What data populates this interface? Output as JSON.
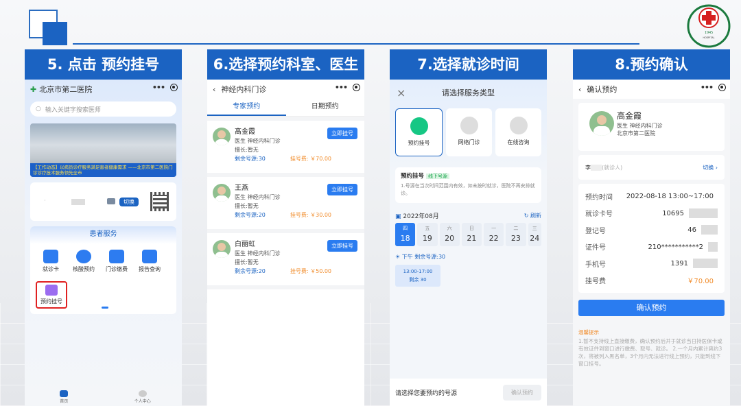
{
  "slides": [
    {
      "title": "5. 点击 预约挂号"
    },
    {
      "title": "6.选择预约科室、医生"
    },
    {
      "title": "7.选择就诊时间"
    },
    {
      "title": "8.预约确认"
    }
  ],
  "screen1": {
    "hospital": "北京市第二医院",
    "search_placeholder": "输入关键字搜索医师",
    "banner_caption": "【工作动态】以病员诊疗服务满足患者健康需求 ——北京市第二医院门诊诊疗技术服务领先全市",
    "card_name": "·",
    "switch_label": "切换",
    "services_title": "患者服务",
    "services": [
      "就诊卡",
      "核酸预约",
      "门诊缴费",
      "报告查询"
    ],
    "highlight_service": "预约挂号",
    "tabbar": [
      "首页",
      "个人中心"
    ]
  },
  "screen2": {
    "dept": "神经内科门诊",
    "tabs": [
      "专家预约",
      "日期预约"
    ],
    "book_label": "立即挂号",
    "doctors": [
      {
        "name": "高金霞",
        "title": "医生 神经内科门诊",
        "skill": "擅长:暂无",
        "remain": "剩余号源:30",
        "fee": "挂号费: ￥70.00"
      },
      {
        "name": "王燕",
        "title": "医生 神经内科门诊",
        "skill": "擅长:暂无",
        "remain": "剩余号源:20",
        "fee": "挂号费: ￥30.00"
      },
      {
        "name": "白丽虹",
        "title": "医生 神经内科门诊",
        "skill": "擅长:暂无",
        "remain": "剩余号源:20",
        "fee": "挂号费: ￥50.00"
      }
    ]
  },
  "screen3": {
    "sheet_title": "请选择服务类型",
    "types": [
      "预约挂号",
      "网络门诊",
      "在线咨询"
    ],
    "desc_title": "预约挂号",
    "desc_tag": "线下号源",
    "desc_text": "1.号源在当次时间范围内有效，如未按时就诊，医院不再安排就诊。",
    "month": "2022年08月",
    "refresh": "刷新",
    "days": [
      {
        "w": "四",
        "d": "18"
      },
      {
        "w": "五",
        "d": "19"
      },
      {
        "w": "六",
        "d": "20"
      },
      {
        "w": "日",
        "d": "21"
      },
      {
        "w": "一",
        "d": "22"
      },
      {
        "w": "二",
        "d": "23"
      },
      {
        "w": "三",
        "d": "24"
      }
    ],
    "period": "下午  剩余号源:30",
    "slot_time": "13:00-17:00",
    "slot_remain": "剩余 30",
    "footer_text": "请选择您要预约的号源",
    "confirm_label": "确认预约"
  },
  "screen4": {
    "header": "确认预约",
    "doctor_name": "高金霞",
    "doctor_title": "医生 神经内科门诊",
    "doctor_hospital": "北京市第二医院",
    "patient": "李",
    "patient_hint": "(就诊人)",
    "switch_label": "切换",
    "rows": [
      {
        "k": "预约时间",
        "v": "2022-08-18 13:00~17:00"
      },
      {
        "k": "就诊卡号",
        "v": "10695"
      },
      {
        "k": "登记号",
        "v": "46"
      },
      {
        "k": "证件号",
        "v": "210***********2"
      },
      {
        "k": "手机号",
        "v": "1391"
      },
      {
        "k": "挂号费",
        "v": "￥70.00"
      }
    ],
    "confirm_label": "确认预约",
    "tips_title": "温馨提示",
    "tips_text": "1.暂不支持线上直接缴费，确认预约后并于就诊当日持医保卡或有效证件到窗口进行缴费、取号、就诊。 2.一个月内累计爽约3次，将被列入黑名单，3个月内无法进行线上预约，只能到线下窗口挂号。"
  },
  "colors": {
    "brand": "#1b63c2",
    "accent": "#2a7cf0",
    "fee": "#f18c2b"
  }
}
